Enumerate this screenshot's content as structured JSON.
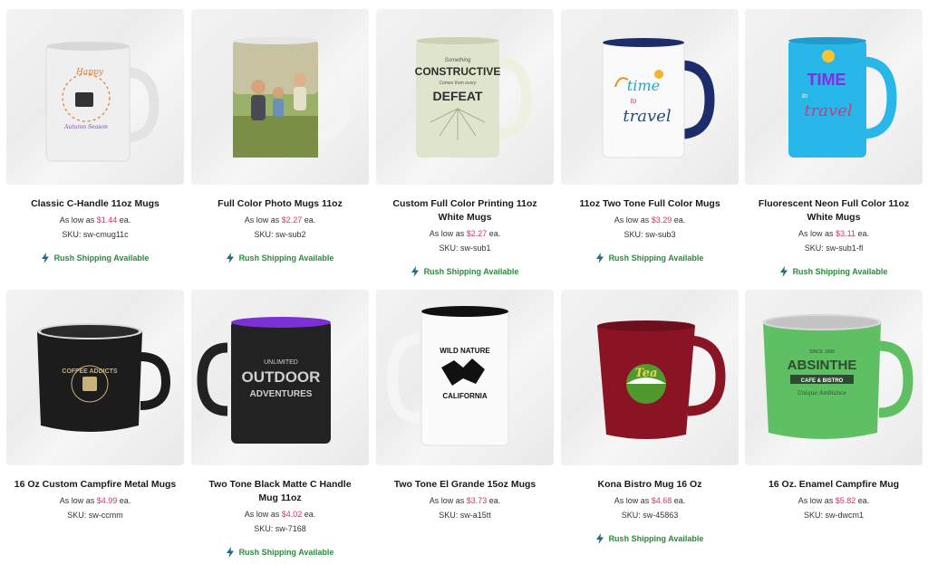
{
  "products": [
    {
      "title": "Classic C-Handle 11oz Mugs",
      "price_prefix": "As low as",
      "price": "$1.44",
      "price_suffix": "ea.",
      "sku": "SKU: sw-cmug11c",
      "rush": "Rush Shipping Available",
      "mug_text": [
        "Happy",
        "Autumn Season"
      ],
      "colors": {
        "body": "#f1f1f1",
        "accent": "#e07b2a"
      }
    },
    {
      "title": "Full Color Photo Mugs 11oz",
      "price_prefix": "As low as",
      "price": "$2.27",
      "price_suffix": "ea.",
      "sku": "SKU: sw-sub2",
      "rush": "Rush Shipping Available",
      "mug_text": [],
      "colors": {
        "body": "#ffffff",
        "accent": "#6e8b3d"
      }
    },
    {
      "title": "Custom Full Color Printing 11oz White Mugs",
      "price_prefix": "As low as",
      "price": "$2.27",
      "price_suffix": "ea.",
      "sku": "SKU: sw-sub1",
      "rush": "Rush Shipping Available",
      "mug_text": [
        "Something",
        "CONSTRUCTIVE",
        "Comes from every",
        "DEFEAT"
      ],
      "colors": {
        "body": "#dfe5cc",
        "accent": "#2d2d2d"
      }
    },
    {
      "title": "11oz Two Tone Full Color Mugs",
      "price_prefix": "As low as",
      "price": "$3.29",
      "price_suffix": "ea.",
      "sku": "SKU: sw-sub3",
      "rush": "Rush Shipping Available",
      "mug_text": [
        "time",
        "to",
        "travel"
      ],
      "colors": {
        "body": "#ffffff",
        "accent": "#1d2d6b"
      }
    },
    {
      "title": "Fluorescent Neon Full Color 11oz White Mugs",
      "price_prefix": "As low as",
      "price": "$3.11",
      "price_suffix": "ea.",
      "sku": "SKU: sw-sub1-fl",
      "rush": "Rush Shipping Available",
      "mug_text": [
        "TIME",
        "to",
        "travel"
      ],
      "colors": {
        "body": "#29b6e8",
        "accent": "#e0317a"
      }
    },
    {
      "title": "16 Oz Custom Campfire Metal Mugs",
      "price_prefix": "As low as",
      "price": "$4.99",
      "price_suffix": "ea.",
      "sku": "SKU: sw-ccmm",
      "rush": "",
      "mug_text": [
        "COFFEE ADDICTS"
      ],
      "colors": {
        "body": "#1c1c1c",
        "accent": "#c9b27a"
      }
    },
    {
      "title": "Two Tone Black Matte C Handle Mug 11oz",
      "price_prefix": "As low as",
      "price": "$4.02",
      "price_suffix": "ea.",
      "sku": "SKU: sw-7168",
      "rush": "Rush Shipping Available",
      "mug_text": [
        "UNLIMITED",
        "OUTDOOR",
        "ADVENTURES"
      ],
      "colors": {
        "body": "#222222",
        "accent": "#7b2fd6"
      }
    },
    {
      "title": "Two Tone El Grande 15oz Mugs",
      "price_prefix": "As low as",
      "price": "$3.73",
      "price_suffix": "ea.",
      "sku": "SKU: sw-a15tt",
      "rush": "",
      "mug_text": [
        "WILD NATURE",
        "CALIFORNIA"
      ],
      "colors": {
        "body": "#ffffff",
        "accent": "#111111"
      }
    },
    {
      "title": "Kona Bistro Mug 16 Oz",
      "price_prefix": "As low as",
      "price": "$4.68",
      "price_suffix": "ea.",
      "sku": "SKU: sw-45863",
      "rush": "Rush Shipping Available",
      "mug_text": [
        "Tea"
      ],
      "colors": {
        "body": "#8a1424",
        "accent": "#4f9a2e"
      }
    },
    {
      "title": "16 Oz. Enamel Campfire Mug",
      "price_prefix": "As low as",
      "price": "$5.82",
      "price_suffix": "ea.",
      "sku": "SKU: sw-dwcm1",
      "rush": "",
      "mug_text": [
        "SINCE 1999",
        "ABSINTHE",
        "CAFE & BISTRO",
        "Unique Ambiance"
      ],
      "colors": {
        "body": "#5fbf63",
        "accent": "#2e4a33"
      }
    }
  ]
}
